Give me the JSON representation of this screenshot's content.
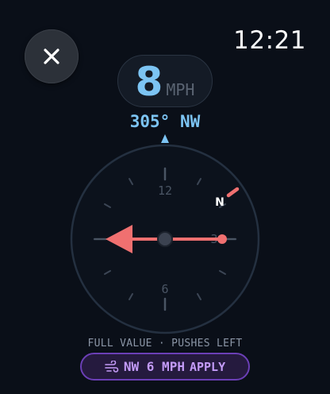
{
  "header": {
    "close_icon": "close-icon",
    "clock": "12:21"
  },
  "speed": {
    "value": "8",
    "unit": "MPH"
  },
  "heading": {
    "text": "305° NW"
  },
  "dial": {
    "labels": {
      "top": "12",
      "bottom": "6",
      "right": "3",
      "north": "N"
    },
    "wind_direction_deg": 305,
    "arrow_direction": "left",
    "colors": {
      "arrow": "#f07070",
      "ring": "#243040",
      "heading": "#7cc4f3"
    }
  },
  "footer": {
    "caption": "FULL VALUE · PUSHES LEFT",
    "apply_summary": "NW 6 MPH",
    "apply_label": "APPLY",
    "apply_icon": "wind-icon",
    "accent": "#c39bf7"
  }
}
